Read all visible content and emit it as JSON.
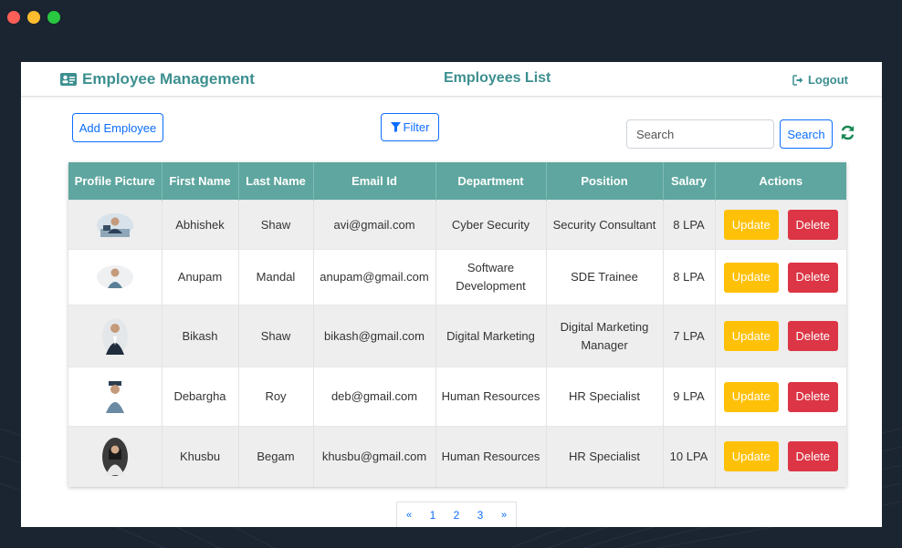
{
  "window": {
    "brand": "Employee Management",
    "title": "Employees List",
    "logout_label": "Logout"
  },
  "toolbar": {
    "add_label": "Add Employee",
    "filter_label": "Filter",
    "search_placeholder": "Search",
    "search_button_label": "Search"
  },
  "table": {
    "columns": [
      "Profile Picture",
      "First Name",
      "Last Name",
      "Email Id",
      "Department",
      "Position",
      "Salary",
      "Actions"
    ],
    "rows": [
      {
        "first": "Abhishek",
        "last": "Shaw",
        "email": "avi@gmail.com",
        "department": "Cyber Security",
        "position": "Security Consultant",
        "salary": "8 LPA"
      },
      {
        "first": "Anupam",
        "last": "Mandal",
        "email": "anupam@gmail.com",
        "department": "Software Development",
        "position": "SDE Trainee",
        "salary": "8 LPA"
      },
      {
        "first": "Bikash",
        "last": "Shaw",
        "email": "bikash@gmail.com",
        "department": "Digital Marketing",
        "position": "Digital Marketing Manager",
        "salary": "7 LPA"
      },
      {
        "first": "Debargha",
        "last": "Roy",
        "email": "deb@gmail.com",
        "department": "Human Resources",
        "position": "HR Specialist",
        "salary": "9 LPA"
      },
      {
        "first": "Khusbu",
        "last": "Begam",
        "email": "khusbu@gmail.com",
        "department": "Human Resources",
        "position": "HR Specialist",
        "salary": "10 LPA"
      }
    ],
    "update_label": "Update",
    "delete_label": "Delete"
  },
  "pagination": {
    "prev": "«",
    "pages": [
      "1",
      "2",
      "3"
    ],
    "next": "»"
  },
  "colors": {
    "accent": "#3d8f90",
    "header_bg": "#5ea69f",
    "primary": "#0d6efd",
    "update": "#ffc107",
    "delete": "#dc3545",
    "refresh": "#198754"
  }
}
